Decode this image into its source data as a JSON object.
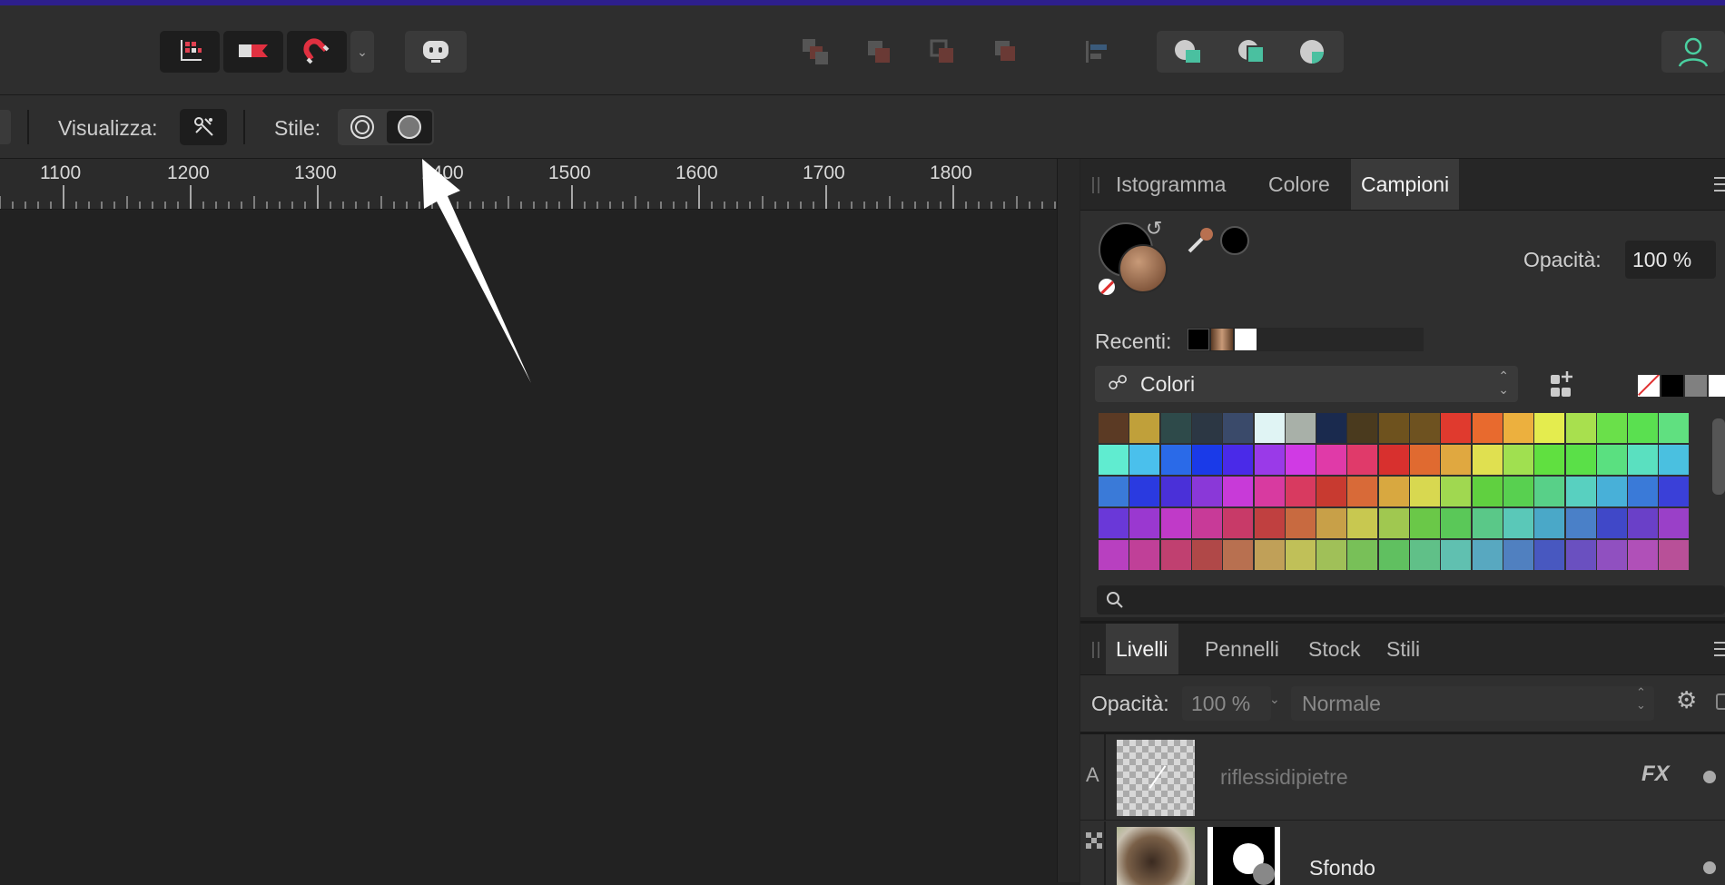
{
  "context_bar": {
    "view_label": "Visualizza:",
    "style_label": "Stile:"
  },
  "ruler": {
    "ticks": [
      "1100",
      "1200",
      "1300",
      "1400",
      "1500",
      "1600",
      "1700",
      "1800"
    ]
  },
  "color_panel": {
    "tabs": [
      "Istogramma",
      "Colore",
      "Campioni"
    ],
    "active_tab": "Campioni",
    "opacity_label": "Opacità:",
    "opacity_value": "100 %",
    "recent_label": "Recenti:",
    "recent_colors": [
      "#000000",
      "#8a5a3a",
      "#ffffff"
    ],
    "palette_name": "Colori",
    "quick_colors": [
      "none",
      "#000000",
      "#808080",
      "#ffffff"
    ],
    "swatches": [
      [
        "#5b3a24",
        "#c0a03a",
        "#2e4a4a",
        "#2c3744",
        "#3a4a6a",
        "#e0f4f4",
        "#a8b0a8",
        "#1a2a4e",
        "#4a3a1e",
        "#6e521e",
        "#6e5220",
        "#e03a2e",
        "#e86a2e",
        "#ecb03e",
        "#e4ec4e",
        "#a8e04e",
        "#6ae04a",
        "#5ae050",
        "#60e080"
      ],
      [
        "#60ecd0",
        "#4ac0ec",
        "#2a6ae8",
        "#1a3ae8",
        "#4a2ae8",
        "#9a3ae8",
        "#d03ae4",
        "#e03aa8",
        "#e03a6a",
        "#d8302e",
        "#e06a30",
        "#e0a840",
        "#e0e050",
        "#a0e050",
        "#60e040",
        "#5ae048",
        "#5ae080",
        "#5ae0c0",
        "#4ac0e0"
      ],
      [
        "#3a7ad8",
        "#2a3ae0",
        "#4a30d8",
        "#8a38d8",
        "#c83ad8",
        "#d83aa0",
        "#d83a60",
        "#c83a30",
        "#d86a38",
        "#d8a840",
        "#d8d850",
        "#a0d850",
        "#60d040",
        "#58d050",
        "#58d088",
        "#58d0c0",
        "#48b0d8",
        "#3a7ad8",
        "#3a40d8"
      ],
      [
        "#6a38d8",
        "#9a38d0",
        "#c03ac8",
        "#c83a98",
        "#c83a68",
        "#c04040",
        "#c86a40",
        "#c8a048",
        "#c8c850",
        "#a0c850",
        "#6ac848",
        "#5ac858",
        "#5ac888",
        "#5ac8b8",
        "#4aa8c8",
        "#4a80c8",
        "#4048c8",
        "#6a40c8",
        "#9a40c8"
      ],
      [
        "#b840c0",
        "#c04098",
        "#c04070",
        "#b04848",
        "#b87050",
        "#c0a058",
        "#c0c058",
        "#a0c058",
        "#78c058",
        "#60c060",
        "#60c088",
        "#60c0b0",
        "#58a8c0",
        "#5080c0",
        "#4858c0",
        "#6a50c0",
        "#9050c0",
        "#b050b8",
        "#b85098"
      ]
    ]
  },
  "layers_panel": {
    "tabs": [
      "Livelli",
      "Pennelli",
      "Stock",
      "Stili"
    ],
    "active_tab": "Livelli",
    "opacity_label": "Opacità:",
    "opacity_value": "100 %",
    "blend_mode": "Normale",
    "layers": [
      {
        "type_glyph": "A",
        "name": "riflessidipietre",
        "fx": "FX"
      },
      {
        "name": "Sfondo"
      }
    ]
  }
}
